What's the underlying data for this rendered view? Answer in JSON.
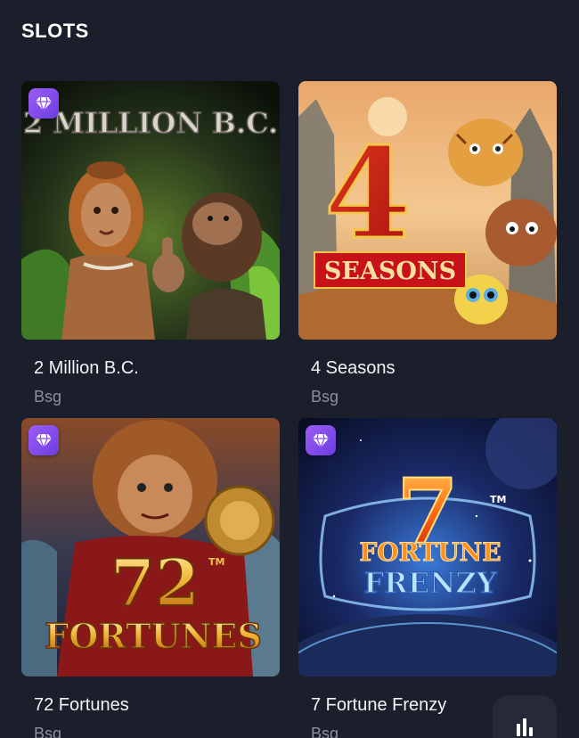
{
  "section": {
    "title": "SLOTS"
  },
  "games": [
    {
      "name": "2 Million B.C.",
      "provider": "Bsg",
      "badge_icon": "diamond-icon",
      "art_text": [
        "2 MILLION B.C."
      ]
    },
    {
      "name": "4 Seasons",
      "provider": "Bsg",
      "badge_icon": "diamond-icon",
      "art_text": [
        "4",
        "SEASONS"
      ]
    },
    {
      "name": "72 Fortunes",
      "provider": "Bsg",
      "badge_icon": "diamond-icon",
      "art_text": [
        "72",
        "FORTUNES",
        "TM"
      ]
    },
    {
      "name": "7 Fortune Frenzy",
      "provider": "Bsg",
      "badge_icon": "diamond-icon",
      "art_text": [
        "7",
        "FORTUNE",
        "FRENZY",
        "TM"
      ]
    }
  ],
  "floating_button": {
    "icon": "bar-chart-icon"
  },
  "colors": {
    "background": "#1a1f2b",
    "badge": "#8b4cf0",
    "provider_text": "#8b909c"
  }
}
